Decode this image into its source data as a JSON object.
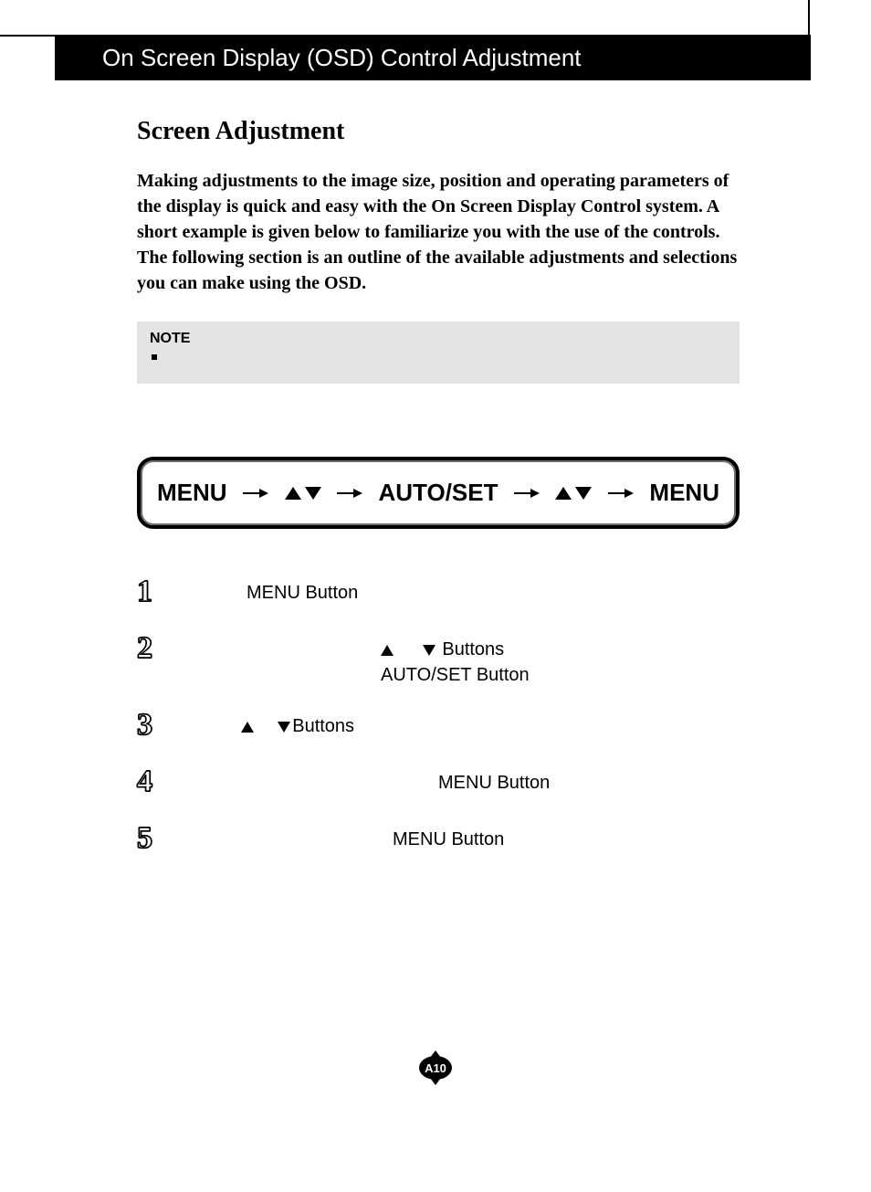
{
  "header": {
    "title": "On Screen Display (OSD) Control Adjustment"
  },
  "section": {
    "title": "Screen Adjustment",
    "intro": "Making adjustments to the image size, position and operating parameters of the display is quick and easy with the On Screen Display Control system. A short example is given below to familiarize you with the use of the controls. The following section is an outline of the available adjustments and selections you can make using the OSD."
  },
  "note": {
    "label": "NOTE"
  },
  "flow": {
    "menu1": "MENU",
    "autoset": "AUTO/SET",
    "menu2": "MENU"
  },
  "steps": {
    "s1": {
      "num": "1",
      "text": "MENU Button"
    },
    "s2": {
      "num": "2",
      "line1_suffix": " Buttons",
      "line2": "AUTO/SET Button"
    },
    "s3": {
      "num": "3",
      "text": "Buttons"
    },
    "s4": {
      "num": "4",
      "text": "MENU Button"
    },
    "s5": {
      "num": "5",
      "text": "MENU Button"
    }
  },
  "page": {
    "number": "A10"
  }
}
